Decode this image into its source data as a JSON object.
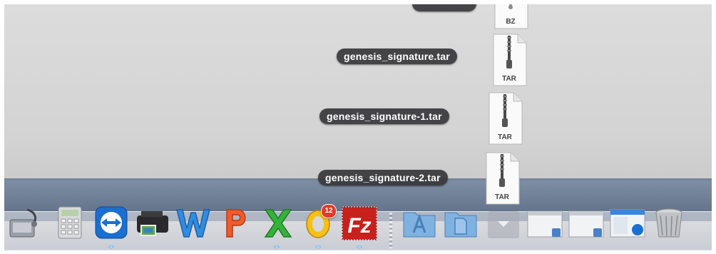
{
  "stack": {
    "partial_label": "",
    "partial_file_ext": "BZ",
    "files": [
      {
        "name": "genesis_signature.tar",
        "ext": "TAR"
      },
      {
        "name": "genesis_signature-1.tar",
        "ext": "TAR"
      },
      {
        "name": "genesis_signature-2.tar",
        "ext": "TAR"
      }
    ]
  },
  "dock": {
    "items": [
      {
        "name": "disk-utility",
        "icon": "disk-utility-icon"
      },
      {
        "name": "calculator",
        "icon": "calculator-icon"
      },
      {
        "name": "teamviewer",
        "icon": "teamviewer-icon"
      },
      {
        "name": "printer",
        "icon": "printer-icon"
      },
      {
        "name": "microsoft-word",
        "icon": "word-icon"
      },
      {
        "name": "microsoft-powerpoint",
        "icon": "powerpoint-icon"
      },
      {
        "name": "microsoft-excel",
        "icon": "excel-icon"
      },
      {
        "name": "microsoft-outlook",
        "icon": "outlook-icon",
        "badge": "12"
      },
      {
        "name": "filezilla",
        "icon": "filezilla-icon",
        "label": "Fz"
      },
      {
        "name": "applications-folder",
        "icon": "applications-folder-icon"
      },
      {
        "name": "documents-folder",
        "icon": "documents-folder-icon"
      },
      {
        "name": "downloads-stack",
        "icon": "downloads-stack-icon"
      },
      {
        "name": "window-thumbnail-1",
        "icon": "window-thumbnail-icon"
      },
      {
        "name": "window-thumbnail-2",
        "icon": "window-thumbnail-icon"
      },
      {
        "name": "window-thumbnail-3",
        "icon": "window-thumbnail-icon"
      },
      {
        "name": "trash",
        "icon": "trash-icon"
      }
    ]
  },
  "colors": {
    "desktop": "#d6d6d6",
    "band": "#6a7a90",
    "label_bg": "#37373a",
    "badge": "#e23a2d"
  }
}
